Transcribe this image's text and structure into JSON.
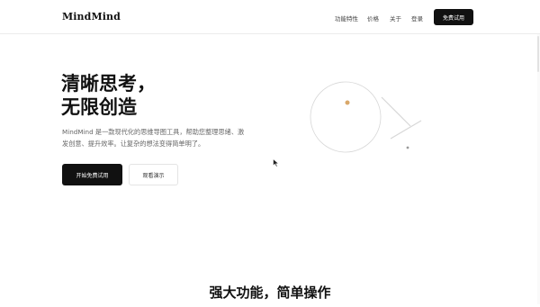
{
  "nav": {
    "logo": "MindMind",
    "links": [
      "功能特性",
      "价格",
      "关于",
      "登录"
    ],
    "cta": "免费试用"
  },
  "hero": {
    "title_line1": "清晰思考，",
    "title_line2": "无限创造",
    "description": "MindMind 是一款现代化的思维导图工具，帮助您整理思绪、激发创意、提升效率。让复杂的想法变得简单明了。",
    "primary_button": "开始免费试用",
    "secondary_button": "观看演示"
  },
  "features": {
    "title": "强大功能，简单操作"
  },
  "colors": {
    "accent": "#111111",
    "orb_dot": "#d9a86a",
    "line": "#d7d7d7"
  },
  "icons": {
    "cursor": "mouse-pointer-icon"
  }
}
